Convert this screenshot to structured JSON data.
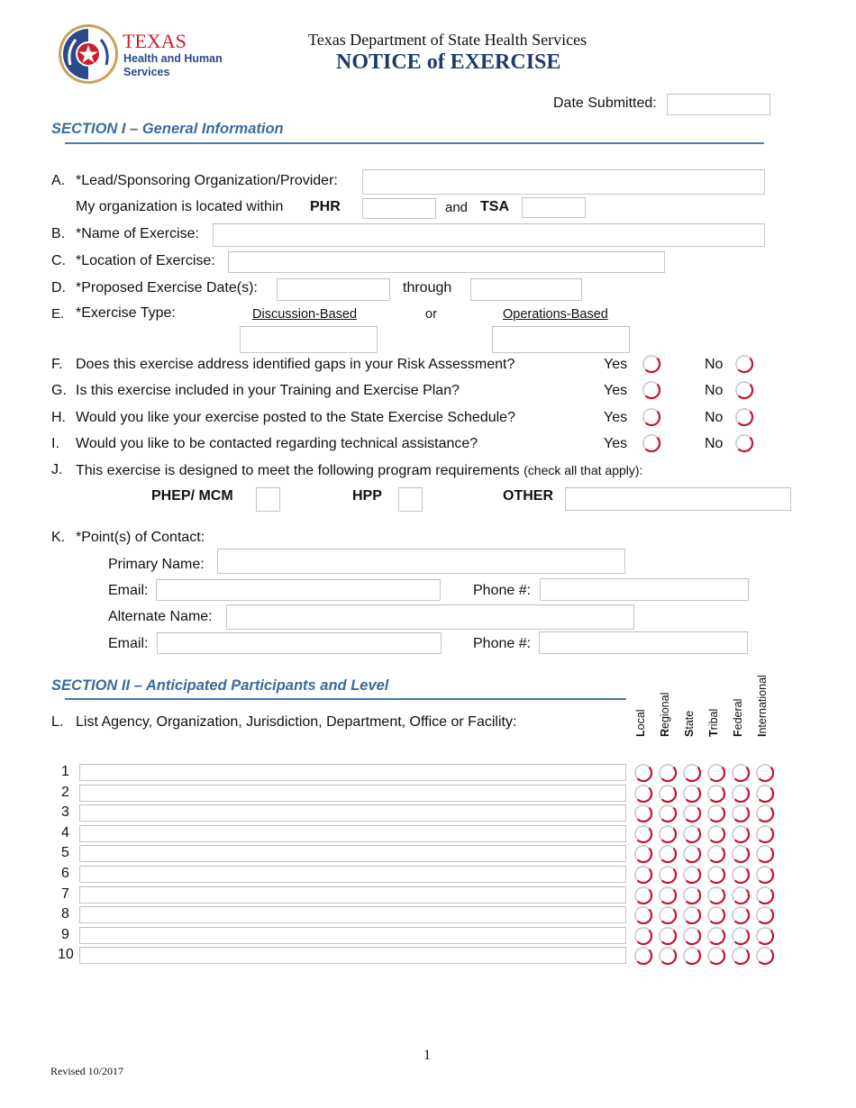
{
  "header": {
    "logo": {
      "name": "TEXAS",
      "line2": "Health and Human",
      "line3": "Services"
    },
    "department": "Texas Department of State Health Services",
    "title": "NOTICE of EXERCISE",
    "date_submitted_label": "Date Submitted:",
    "date_submitted_value": ""
  },
  "colors": {
    "section_blue": "#3c6a9e",
    "title_navy": "#1f3a6a",
    "logo_red": "#c8202f",
    "radio_red": "#c8102e"
  },
  "section1": {
    "title": "SECTION I – General Information",
    "A": {
      "letter": "A.",
      "label": "*Lead/Sponsoring Organization/Provider:",
      "value": ""
    },
    "A2": {
      "label": "My organization is located within",
      "phr_label": "PHR",
      "phr_value": "",
      "and_label": "and",
      "tsa_label": "TSA",
      "tsa_value": ""
    },
    "B": {
      "letter": "B.",
      "label": "*Name of Exercise:",
      "value": ""
    },
    "C": {
      "letter": "C.",
      "label": "*Location of Exercise:",
      "value": ""
    },
    "D": {
      "letter": "D.",
      "label": "*Proposed Exercise Date(s):",
      "start_value": "",
      "through_label": "through",
      "end_value": ""
    },
    "E": {
      "letter": "E.",
      "label": "*Exercise Type:",
      "discussion_label": "Discussion-Based",
      "or_label": "or",
      "operations_label": "Operations-Based",
      "discussion_value": "",
      "operations_value": ""
    },
    "questions": [
      {
        "letter": "F.",
        "text": "Does this exercise address identified gaps in your Risk Assessment?",
        "yes": "Yes",
        "no": "No",
        "selected": null
      },
      {
        "letter": "G.",
        "text": "Is this exercise included in your Training and Exercise Plan?",
        "yes": "Yes",
        "no": "No",
        "selected": null
      },
      {
        "letter": "H.",
        "text": "Would you like your exercise posted to the State Exercise Schedule?",
        "yes": "Yes",
        "no": "No",
        "selected": null
      },
      {
        "letter": "I.",
        "text": "Would you like to be contacted regarding technical assistance?",
        "yes": "Yes",
        "no": "No",
        "selected": null
      }
    ],
    "J": {
      "letter": "J.",
      "text": "This exercise is designed to meet the following program requirements",
      "note": "(check all that apply):",
      "phep_label": "PHEP/ MCM",
      "phep_checked": false,
      "hpp_label": "HPP",
      "hpp_checked": false,
      "other_label": "OTHER",
      "other_value": ""
    },
    "K": {
      "letter": "K.",
      "label": "*Point(s) of Contact:",
      "primary_name_label": "Primary Name:",
      "primary_name_value": "",
      "email1_label": "Email:",
      "email1_value": "",
      "phone1_label": "Phone #:",
      "phone1_value": "",
      "alternate_name_label": "Alternate Name:",
      "alternate_name_value": "",
      "email2_label": "Email:",
      "email2_value": "",
      "phone2_label": "Phone #:",
      "phone2_value": ""
    }
  },
  "section2": {
    "title": "SECTION II – Anticipated Participants and Level",
    "L": {
      "letter": "L.",
      "label": "List Agency, Organization, Jurisdiction, Department, Office or Facility:"
    },
    "levels": [
      {
        "first": "L",
        "rest": "ocal"
      },
      {
        "first": "R",
        "rest": "egional"
      },
      {
        "first": "S",
        "rest": "tate"
      },
      {
        "first": "T",
        "rest": "ribal"
      },
      {
        "first": "F",
        "rest": "ederal"
      },
      {
        "first": "I",
        "rest": "nternational"
      }
    ],
    "rows": [
      {
        "num": "1",
        "value": ""
      },
      {
        "num": "2",
        "value": ""
      },
      {
        "num": "3",
        "value": ""
      },
      {
        "num": "4",
        "value": ""
      },
      {
        "num": "5",
        "value": ""
      },
      {
        "num": "6",
        "value": ""
      },
      {
        "num": "7",
        "value": ""
      },
      {
        "num": "8",
        "value": ""
      },
      {
        "num": "9",
        "value": ""
      },
      {
        "num": "10",
        "value": ""
      }
    ]
  },
  "footer": {
    "page_number": "1",
    "revised": "Revised 10/2017"
  }
}
